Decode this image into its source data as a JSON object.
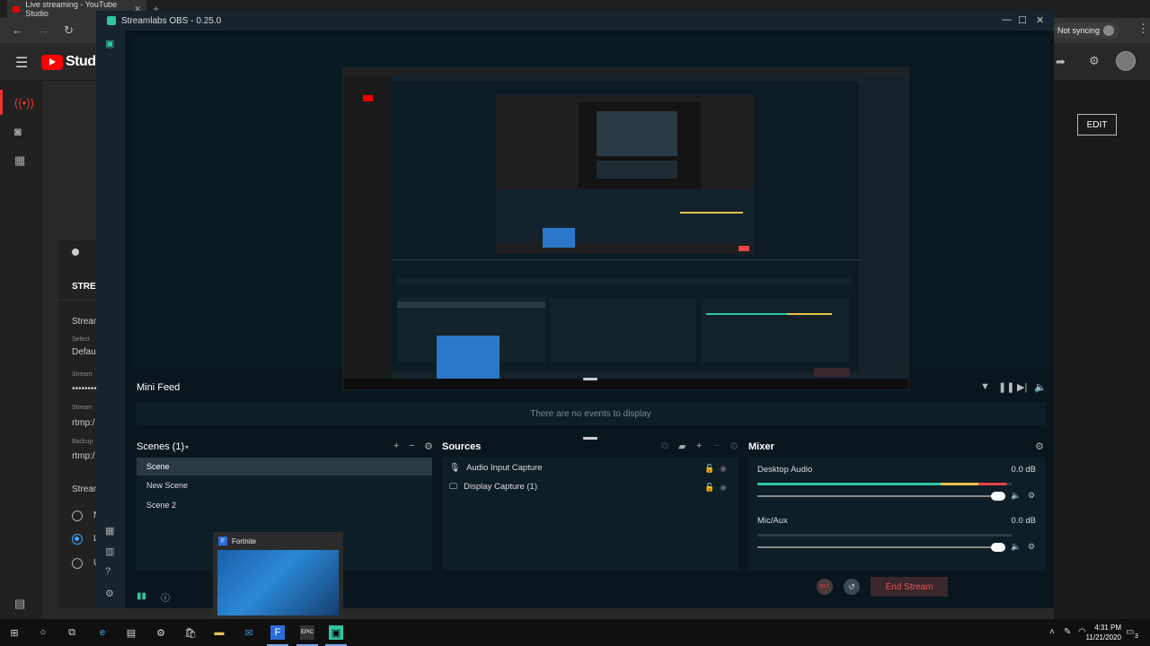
{
  "browser": {
    "tab_title": "Live streaming - YouTube Studio",
    "sync_label": "Not syncing",
    "logo_text": "Studio"
  },
  "youtube": {
    "left_labels": [
      "STREA",
      "Stream",
      "Select",
      "Defau",
      "Stream",
      "••••••••",
      "Stream",
      "rtmp:/",
      "Backup",
      "rtmp:/",
      "Stream",
      "N",
      "L",
      "U"
    ],
    "edit_label": "EDIT"
  },
  "obs": {
    "window_title": "Streamlabs OBS - 0.25.0",
    "minifeed_title": "Mini Feed",
    "minifeed_empty": "There are no events to display",
    "scenes_title": "Scenes (1)",
    "scenes": [
      {
        "label": "Scene",
        "selected": true
      },
      {
        "label": "New Scene",
        "selected": false
      },
      {
        "label": "Scene 2",
        "selected": false
      }
    ],
    "sources_title": "Sources",
    "sources": [
      {
        "label": "Audio Input Capture",
        "icon": "microphone-icon"
      },
      {
        "label": "Display Capture (1)",
        "icon": "monitor-icon"
      }
    ],
    "mixer_title": "Mixer",
    "mixer": [
      {
        "name": "Desktop Audio",
        "db": "0.0 dB",
        "level": 0.98
      },
      {
        "name": "Mic/Aux",
        "db": "0.0 dB",
        "level": 0.0
      }
    ],
    "end_stream_label": "End Stream",
    "rec_label": "REC"
  },
  "thumbnail": {
    "title": "Fortnite"
  },
  "taskbar": {
    "time": "4:31 PM",
    "date": "11/21/2020",
    "notif_count": "3"
  },
  "colors": {
    "accent": "#31c3a2",
    "end_stream": "#e85454",
    "meter_green": "#31c3a2",
    "meter_yellow": "#e5c14b",
    "meter_red": "#e8444b"
  }
}
